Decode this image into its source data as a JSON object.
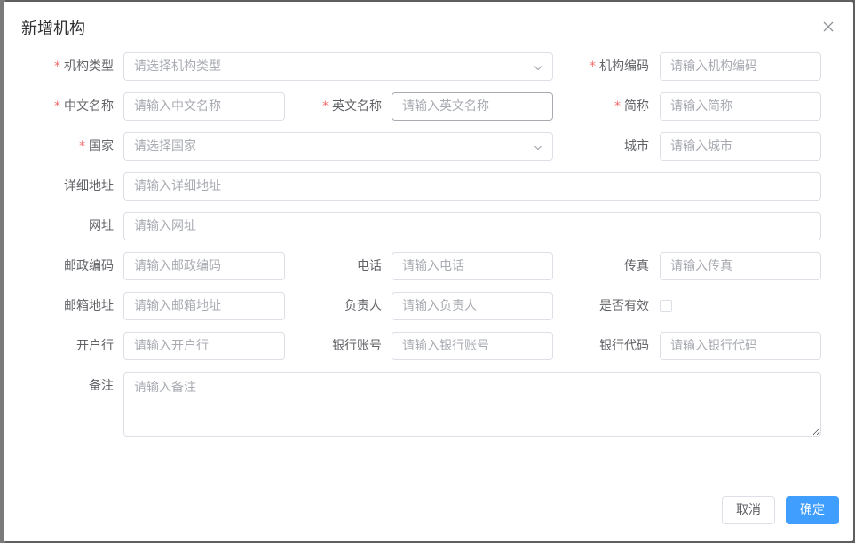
{
  "dialog": {
    "title": "新增机构",
    "cancel_label": "取消",
    "confirm_label": "确定"
  },
  "form": {
    "org_type": {
      "label": "机构类型",
      "placeholder": "请选择机构类型",
      "required": "*"
    },
    "org_code": {
      "label": "机构编码",
      "placeholder": "请输入机构编码",
      "required": "*"
    },
    "cn_name": {
      "label": "中文名称",
      "placeholder": "请输入中文名称",
      "required": "*"
    },
    "en_name": {
      "label": "英文名称",
      "placeholder": "请输入英文名称",
      "required": "*"
    },
    "short_name": {
      "label": "简称",
      "placeholder": "请输入简称",
      "required": "*"
    },
    "country": {
      "label": "国家",
      "placeholder": "请选择国家",
      "required": "*"
    },
    "city": {
      "label": "城市",
      "placeholder": "请输入城市"
    },
    "address": {
      "label": "详细地址",
      "placeholder": "请输入详细地址"
    },
    "website": {
      "label": "网址",
      "placeholder": "请输入网址"
    },
    "postcode": {
      "label": "邮政编码",
      "placeholder": "请输入邮政编码"
    },
    "phone": {
      "label": "电话",
      "placeholder": "请输入电话"
    },
    "fax": {
      "label": "传真",
      "placeholder": "请输入传真"
    },
    "email": {
      "label": "邮箱地址",
      "placeholder": "请输入邮箱地址"
    },
    "owner": {
      "label": "负责人",
      "placeholder": "请输入负责人"
    },
    "is_valid": {
      "label": "是否有效",
      "checked": false
    },
    "bank": {
      "label": "开户行",
      "placeholder": "请输入开户行"
    },
    "bank_account": {
      "label": "银行账号",
      "placeholder": "请输入银行账号"
    },
    "bank_code": {
      "label": "银行代码",
      "placeholder": "请输入银行代码"
    },
    "remark": {
      "label": "备注",
      "placeholder": "请输入备注"
    }
  },
  "colors": {
    "required": "#f56c6c",
    "primary": "#409eff",
    "border": "#dcdfe6",
    "placeholder": "#a8abb2"
  },
  "icons": {
    "close": "close-icon",
    "dropdown": "chevron-down-icon"
  }
}
